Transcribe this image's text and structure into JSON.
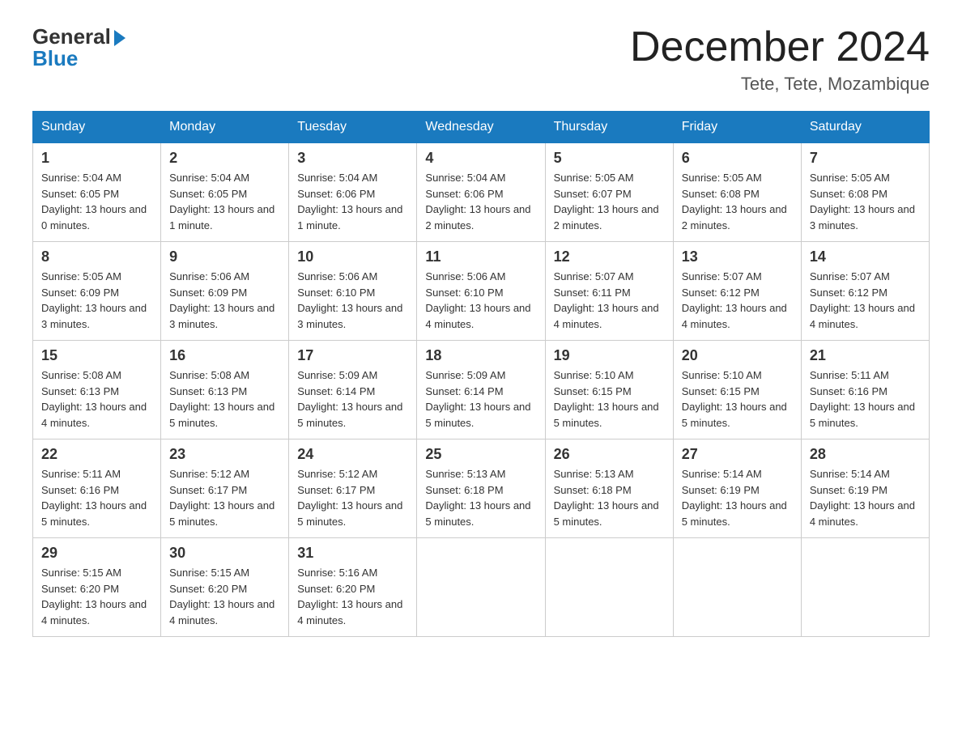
{
  "logo": {
    "general": "General",
    "blue": "Blue"
  },
  "title": "December 2024",
  "location": "Tete, Tete, Mozambique",
  "days_of_week": [
    "Sunday",
    "Monday",
    "Tuesday",
    "Wednesday",
    "Thursday",
    "Friday",
    "Saturday"
  ],
  "weeks": [
    [
      {
        "num": "1",
        "sunrise": "5:04 AM",
        "sunset": "6:05 PM",
        "daylight": "13 hours and 0 minutes."
      },
      {
        "num": "2",
        "sunrise": "5:04 AM",
        "sunset": "6:05 PM",
        "daylight": "13 hours and 1 minute."
      },
      {
        "num": "3",
        "sunrise": "5:04 AM",
        "sunset": "6:06 PM",
        "daylight": "13 hours and 1 minute."
      },
      {
        "num": "4",
        "sunrise": "5:04 AM",
        "sunset": "6:06 PM",
        "daylight": "13 hours and 2 minutes."
      },
      {
        "num": "5",
        "sunrise": "5:05 AM",
        "sunset": "6:07 PM",
        "daylight": "13 hours and 2 minutes."
      },
      {
        "num": "6",
        "sunrise": "5:05 AM",
        "sunset": "6:08 PM",
        "daylight": "13 hours and 2 minutes."
      },
      {
        "num": "7",
        "sunrise": "5:05 AM",
        "sunset": "6:08 PM",
        "daylight": "13 hours and 3 minutes."
      }
    ],
    [
      {
        "num": "8",
        "sunrise": "5:05 AM",
        "sunset": "6:09 PM",
        "daylight": "13 hours and 3 minutes."
      },
      {
        "num": "9",
        "sunrise": "5:06 AM",
        "sunset": "6:09 PM",
        "daylight": "13 hours and 3 minutes."
      },
      {
        "num": "10",
        "sunrise": "5:06 AM",
        "sunset": "6:10 PM",
        "daylight": "13 hours and 3 minutes."
      },
      {
        "num": "11",
        "sunrise": "5:06 AM",
        "sunset": "6:10 PM",
        "daylight": "13 hours and 4 minutes."
      },
      {
        "num": "12",
        "sunrise": "5:07 AM",
        "sunset": "6:11 PM",
        "daylight": "13 hours and 4 minutes."
      },
      {
        "num": "13",
        "sunrise": "5:07 AM",
        "sunset": "6:12 PM",
        "daylight": "13 hours and 4 minutes."
      },
      {
        "num": "14",
        "sunrise": "5:07 AM",
        "sunset": "6:12 PM",
        "daylight": "13 hours and 4 minutes."
      }
    ],
    [
      {
        "num": "15",
        "sunrise": "5:08 AM",
        "sunset": "6:13 PM",
        "daylight": "13 hours and 4 minutes."
      },
      {
        "num": "16",
        "sunrise": "5:08 AM",
        "sunset": "6:13 PM",
        "daylight": "13 hours and 5 minutes."
      },
      {
        "num": "17",
        "sunrise": "5:09 AM",
        "sunset": "6:14 PM",
        "daylight": "13 hours and 5 minutes."
      },
      {
        "num": "18",
        "sunrise": "5:09 AM",
        "sunset": "6:14 PM",
        "daylight": "13 hours and 5 minutes."
      },
      {
        "num": "19",
        "sunrise": "5:10 AM",
        "sunset": "6:15 PM",
        "daylight": "13 hours and 5 minutes."
      },
      {
        "num": "20",
        "sunrise": "5:10 AM",
        "sunset": "6:15 PM",
        "daylight": "13 hours and 5 minutes."
      },
      {
        "num": "21",
        "sunrise": "5:11 AM",
        "sunset": "6:16 PM",
        "daylight": "13 hours and 5 minutes."
      }
    ],
    [
      {
        "num": "22",
        "sunrise": "5:11 AM",
        "sunset": "6:16 PM",
        "daylight": "13 hours and 5 minutes."
      },
      {
        "num": "23",
        "sunrise": "5:12 AM",
        "sunset": "6:17 PM",
        "daylight": "13 hours and 5 minutes."
      },
      {
        "num": "24",
        "sunrise": "5:12 AM",
        "sunset": "6:17 PM",
        "daylight": "13 hours and 5 minutes."
      },
      {
        "num": "25",
        "sunrise": "5:13 AM",
        "sunset": "6:18 PM",
        "daylight": "13 hours and 5 minutes."
      },
      {
        "num": "26",
        "sunrise": "5:13 AM",
        "sunset": "6:18 PM",
        "daylight": "13 hours and 5 minutes."
      },
      {
        "num": "27",
        "sunrise": "5:14 AM",
        "sunset": "6:19 PM",
        "daylight": "13 hours and 5 minutes."
      },
      {
        "num": "28",
        "sunrise": "5:14 AM",
        "sunset": "6:19 PM",
        "daylight": "13 hours and 4 minutes."
      }
    ],
    [
      {
        "num": "29",
        "sunrise": "5:15 AM",
        "sunset": "6:20 PM",
        "daylight": "13 hours and 4 minutes."
      },
      {
        "num": "30",
        "sunrise": "5:15 AM",
        "sunset": "6:20 PM",
        "daylight": "13 hours and 4 minutes."
      },
      {
        "num": "31",
        "sunrise": "5:16 AM",
        "sunset": "6:20 PM",
        "daylight": "13 hours and 4 minutes."
      },
      null,
      null,
      null,
      null
    ]
  ]
}
